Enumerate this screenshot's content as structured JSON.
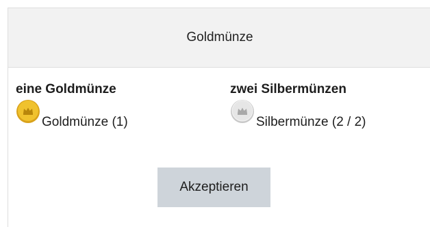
{
  "dialog": {
    "title": "Goldmünze"
  },
  "rewards": [
    {
      "heading": "eine Goldmünze",
      "label": "Goldmünze (1)",
      "icon": "gold-coin-icon",
      "color": "#e8b923"
    },
    {
      "heading": "zwei Silbermünzen",
      "label": "Silbermünze (2 / 2)",
      "icon": "silver-coin-icon",
      "color": "#dcdcdc"
    }
  ],
  "actions": {
    "accept_label": "Akzeptieren",
    "accept_color": "#ced4da"
  }
}
